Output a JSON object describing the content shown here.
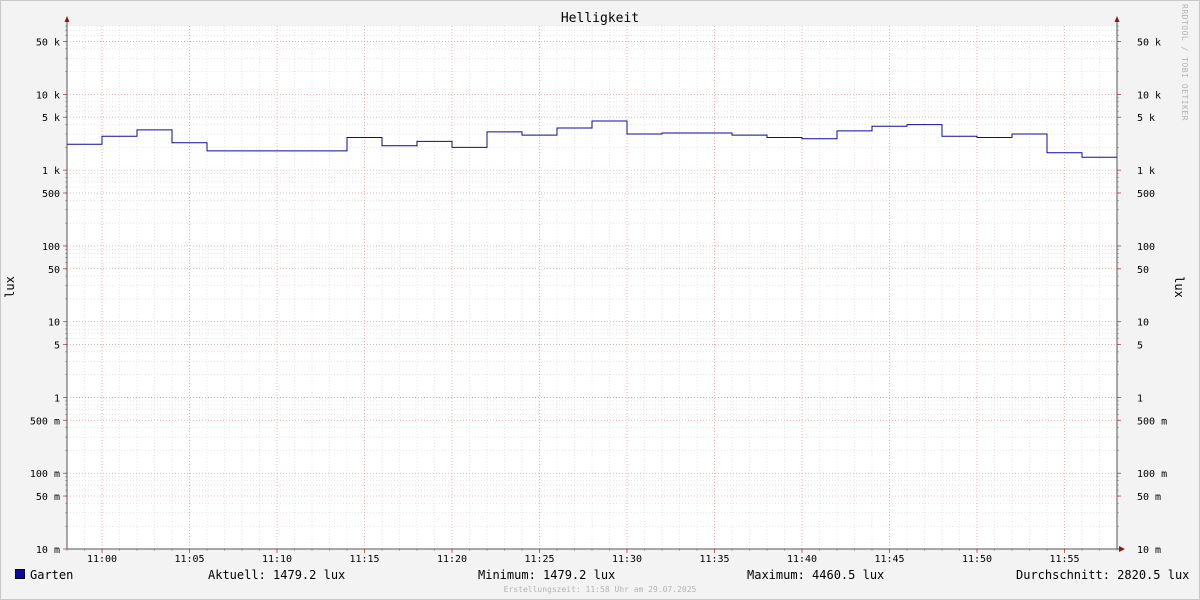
{
  "chart_data": {
    "type": "line",
    "title": "Helligkeit",
    "ylabel": "lux",
    "yscale": "log",
    "ylim": [
      0.01,
      80000
    ],
    "xlim": [
      "10:58:00",
      "11:58:00"
    ],
    "grid": true,
    "x_ticks": [
      "11:00",
      "11:05",
      "11:10",
      "11:15",
      "11:20",
      "11:25",
      "11:30",
      "11:35",
      "11:40",
      "11:45",
      "11:50",
      "11:55"
    ],
    "y_ticks": [
      {
        "value": 50000,
        "label": "50 k"
      },
      {
        "value": 10000,
        "label": "10 k"
      },
      {
        "value": 5000,
        "label": "5 k"
      },
      {
        "value": 1000,
        "label": "1 k"
      },
      {
        "value": 500,
        "label": "500"
      },
      {
        "value": 100,
        "label": "100"
      },
      {
        "value": 50,
        "label": "50"
      },
      {
        "value": 10,
        "label": "10"
      },
      {
        "value": 5,
        "label": "5"
      },
      {
        "value": 1,
        "label": "1"
      },
      {
        "value": 0.5,
        "label": "500 m"
      },
      {
        "value": 0.1,
        "label": "100 m"
      },
      {
        "value": 0.05,
        "label": "50 m"
      },
      {
        "value": 0.01,
        "label": "10 m"
      }
    ],
    "series": [
      {
        "name": "Garten",
        "color": "#0a0aa0",
        "step": true,
        "x": [
          "10:58",
          "11:00",
          "11:02",
          "11:04",
          "11:06",
          "11:08",
          "11:10",
          "11:12",
          "11:14",
          "11:16",
          "11:18",
          "11:20",
          "11:22",
          "11:24",
          "11:26",
          "11:28",
          "11:30",
          "11:32",
          "11:34",
          "11:36",
          "11:38",
          "11:40",
          "11:42",
          "11:44",
          "11:46",
          "11:48",
          "11:50",
          "11:52",
          "11:54",
          "11:56"
        ],
        "values": [
          2200,
          2800,
          3400,
          2300,
          1800,
          1800,
          1800,
          1800,
          2700,
          2100,
          2400,
          2000,
          3200,
          2900,
          3600,
          4460.5,
          3000,
          3100,
          3100,
          2900,
          2700,
          2600,
          3300,
          3800,
          4000,
          2800,
          2700,
          3000,
          1700,
          1479.2
        ]
      }
    ]
  },
  "legend": {
    "series_name": "Garten",
    "current": "Aktuell: 1479.2 lux",
    "minimum": "Minimum: 1479.2 lux",
    "maximum": "Maximum: 4460.5 lux",
    "average": "Durchschnitt: 2820.5 lux"
  },
  "footer": "Erstellungszeit: 11:58 Uhr am 29.07.2025",
  "watermark": "RRDTOOL / TOBI OETIKER"
}
